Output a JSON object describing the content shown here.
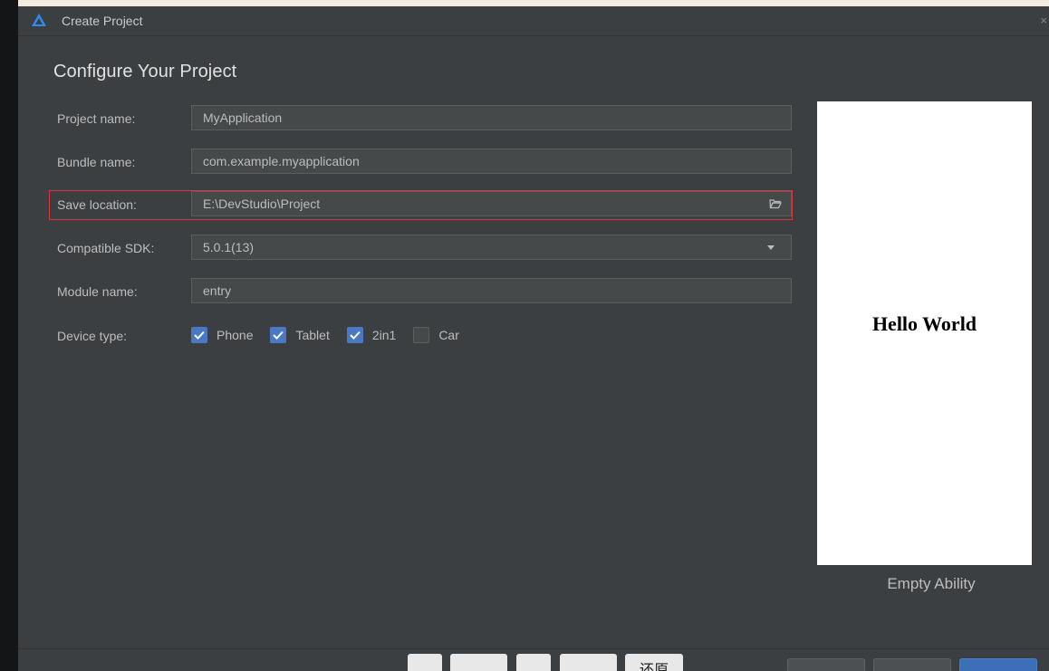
{
  "window": {
    "title": "Create Project",
    "close_label": "×"
  },
  "page": {
    "heading": "Configure Your Project"
  },
  "form": {
    "project_name": {
      "label": "Project name:",
      "value": "MyApplication"
    },
    "bundle_name": {
      "label": "Bundle name:",
      "value": "com.example.myapplication"
    },
    "save_location": {
      "label": "Save location:",
      "value": "E:\\DevStudio\\Project"
    },
    "compatible_sdk": {
      "label": "Compatible SDK:",
      "value": "5.0.1(13)"
    },
    "module_name": {
      "label": "Module name:",
      "value": "entry"
    },
    "device_type": {
      "label": "Device type:",
      "options": [
        {
          "label": "Phone",
          "checked": true
        },
        {
          "label": "Tablet",
          "checked": true
        },
        {
          "label": "2in1",
          "checked": true
        },
        {
          "label": "Car",
          "checked": false
        }
      ]
    }
  },
  "preview": {
    "text": "Hello World",
    "template_name": "Empty Ability"
  },
  "taskbar": {
    "partial_label": "还原"
  },
  "colors": {
    "accent": "#4a78c2",
    "highlight_border": "#d9363e",
    "dialog_bg": "#3c3f41"
  }
}
